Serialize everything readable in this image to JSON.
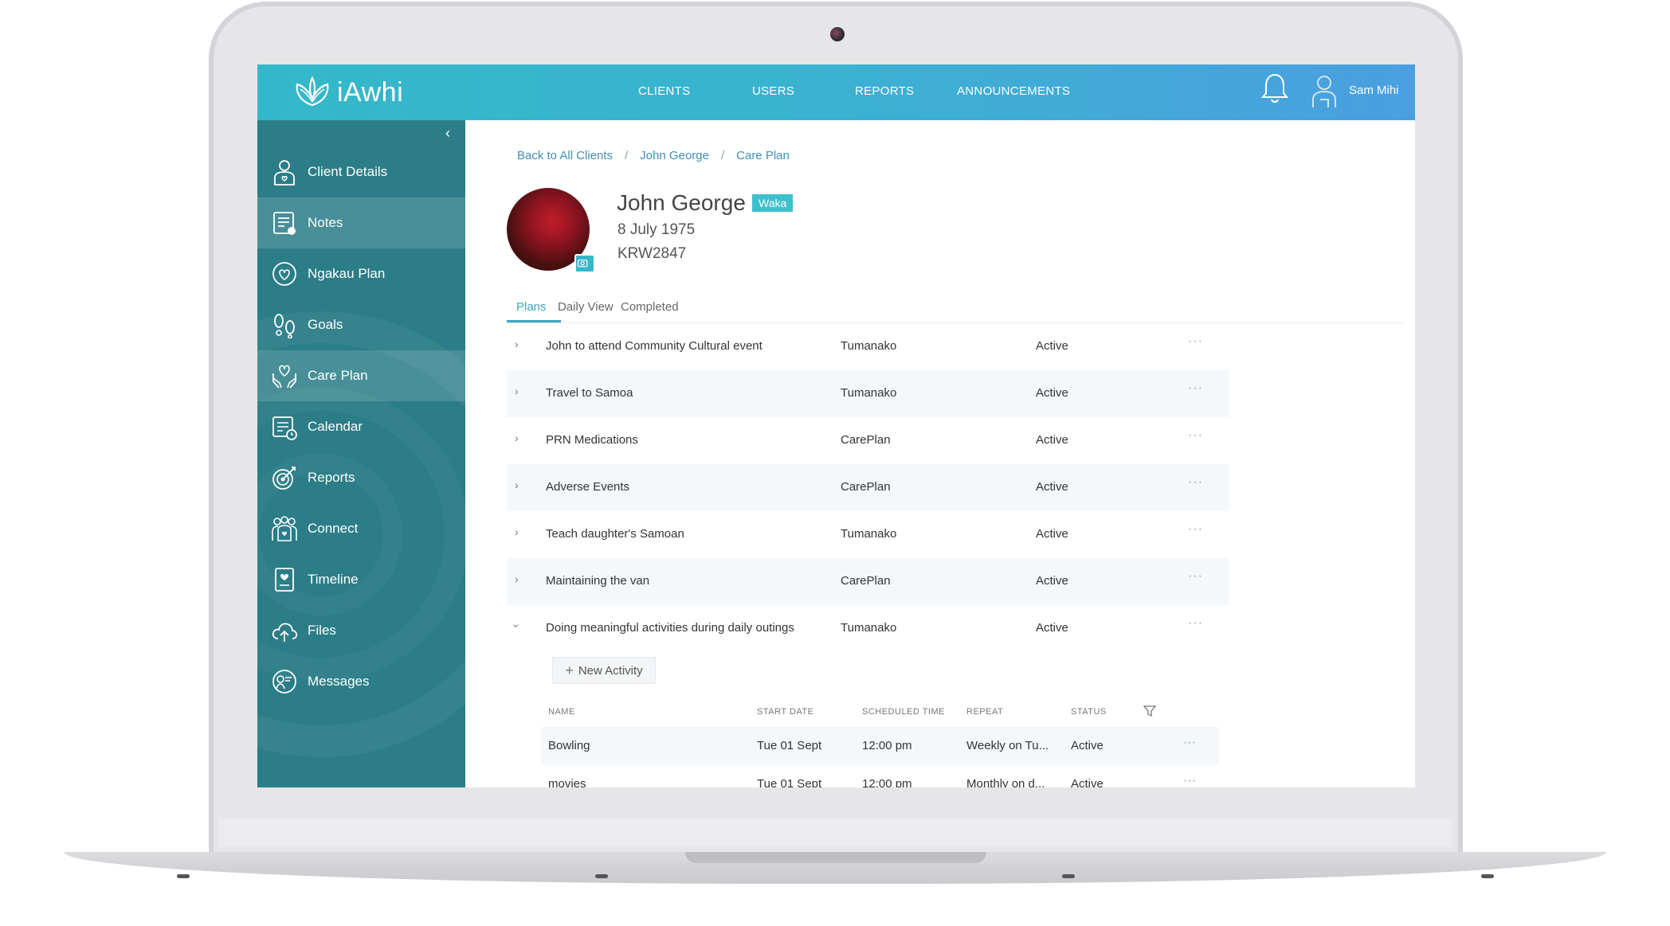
{
  "app": {
    "logo_text": "iAwhi",
    "nav": [
      "CLIENTS",
      "USERS",
      "REPORTS",
      "ANNOUNCEMENTS"
    ],
    "user_name": "Sam Mihi"
  },
  "sidebar": {
    "collapse_glyph": "‹",
    "items": [
      {
        "label": "Client Details",
        "icon": "person-icon"
      },
      {
        "label": "Notes",
        "icon": "notes-icon"
      },
      {
        "label": "Ngakau Plan",
        "icon": "heart-plan-icon"
      },
      {
        "label": "Goals",
        "icon": "footsteps-icon"
      },
      {
        "label": "Care Plan",
        "icon": "care-hands-icon"
      },
      {
        "label": "Calendar",
        "icon": "calendar-clock-icon"
      },
      {
        "label": "Reports",
        "icon": "target-icon"
      },
      {
        "label": "Connect",
        "icon": "people-icon"
      },
      {
        "label": "Timeline",
        "icon": "timeline-icon"
      },
      {
        "label": "Files",
        "icon": "cloud-upload-icon"
      },
      {
        "label": "Messages",
        "icon": "messages-icon"
      }
    ]
  },
  "breadcrumb": [
    "Back to All Clients",
    "John George",
    "Care Plan"
  ],
  "breadcrumb_separator": "/",
  "client": {
    "name": "John George",
    "tag": "Waka",
    "dob": "8 July 1975",
    "id": "KRW2847"
  },
  "tabs": [
    "Plans",
    "Daily View",
    "Completed"
  ],
  "plans": [
    {
      "name": "John to attend Community Cultural event",
      "type": "Tumanako",
      "status": "Active",
      "expanded": false
    },
    {
      "name": "Travel to Samoa",
      "type": "Tumanako",
      "status": "Active",
      "expanded": false
    },
    {
      "name": "PRN Medications",
      "type": "CarePlan",
      "status": "Active",
      "expanded": false
    },
    {
      "name": "Adverse Events",
      "type": "CarePlan",
      "status": "Active",
      "expanded": false
    },
    {
      "name": "Teach daughter's Samoan",
      "type": "Tumanako",
      "status": "Active",
      "expanded": false
    },
    {
      "name": "Maintaining the van",
      "type": "CarePlan",
      "status": "Active",
      "expanded": false
    },
    {
      "name": "Doing meaningful activities during daily outings",
      "type": "Tumanako",
      "status": "Active",
      "expanded": true
    }
  ],
  "more_glyph": "···",
  "new_activity_label": "New Activity",
  "activities": {
    "columns": [
      "NAME",
      "START DATE",
      "SCHEDULED TIME",
      "REPEAT",
      "STATUS"
    ],
    "rows": [
      {
        "name": "Bowling",
        "start": "Tue 01 Sept",
        "time": "12:00 pm",
        "repeat": "Weekly on Tu...",
        "status": "Active"
      },
      {
        "name": "movies",
        "start": "Tue 01 Sept",
        "time": "12:00 pm",
        "repeat": "Monthly on d...",
        "status": "Active"
      }
    ]
  },
  "colors": {
    "topbar_start": "#34b8c9",
    "topbar_end": "#4a9fe0",
    "sidebar": "#2b7d87",
    "accent": "#3aa7c0",
    "tag": "#3cc0cc"
  }
}
